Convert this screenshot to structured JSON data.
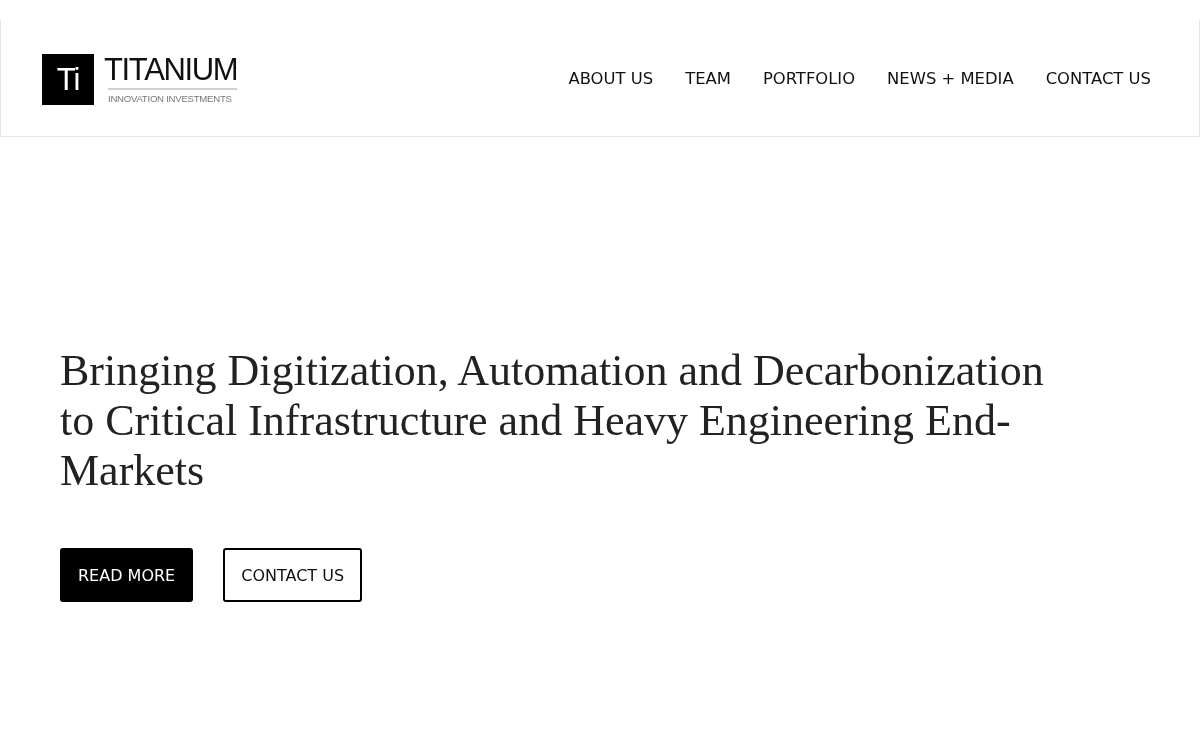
{
  "header": {
    "logo": {
      "mark": "Ti",
      "name": "TITANIUM",
      "tagline": "INNOVATION INVESTMENTS"
    },
    "nav": [
      "ABOUT US",
      "TEAM",
      "PORTFOLIO",
      "NEWS + MEDIA",
      "CONTACT US"
    ]
  },
  "hero": {
    "heading": "Bringing Digitization, Automation and Decarbonization to Critical Infrastructure and Heavy Engineering End-Markets",
    "buttons": [
      {
        "label": "READ MORE",
        "kind": "filled"
      },
      {
        "label": "CONTACT US",
        "kind": "outline"
      }
    ]
  }
}
